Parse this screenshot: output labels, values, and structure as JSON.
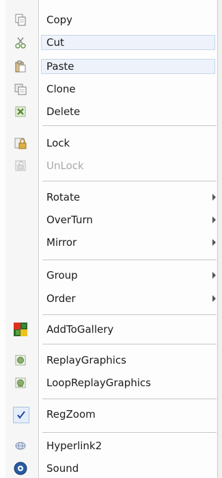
{
  "menu": {
    "copy": "Copy",
    "cut": "Cut",
    "paste": "Paste",
    "clone": "Clone",
    "delete": "Delete",
    "lock": "Lock",
    "unlock": "UnLock",
    "rotate": "Rotate",
    "overturn": "OverTurn",
    "mirror": "Mirror",
    "group": "Group",
    "order": "Order",
    "add_to_gallery": "AddToGallery",
    "replay_graphics": "ReplayGraphics",
    "loop_replay_graphics": "LoopReplayGraphics",
    "reg_zoom": "RegZoom",
    "hyperlink2": "Hyperlink2",
    "sound": "Sound",
    "reg_zoom_checked": true,
    "disabled_items": [
      "UnLock"
    ],
    "highlighted_items": [
      "Cut",
      "Paste"
    ]
  }
}
